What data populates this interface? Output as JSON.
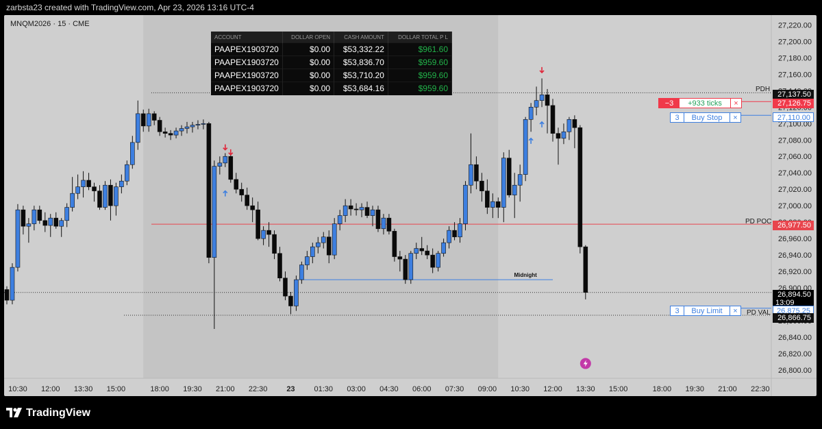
{
  "header": {
    "text": "zarbsta23 created with TradingView.com, Apr 23, 2026 13:16 UTC-4"
  },
  "symbol": {
    "text": "MNQM2026 · 15 · CME"
  },
  "account_table": {
    "columns": [
      "ACCOUNT",
      "DOLLAR OPEN",
      "CASH AMOUNT",
      "DOLLAR TOTAL P L"
    ],
    "rows": [
      [
        "PAAPEX1903720",
        "$0.00",
        "$53,332.22",
        "$961.60"
      ],
      [
        "PAAPEX1903720",
        "$0.00",
        "$53,836.70",
        "$959.60"
      ],
      [
        "PAAPEX1903720",
        "$0.00",
        "$53,710.20",
        "$959.60"
      ],
      [
        "PAAPEX1903720",
        "$0.00",
        "$53,684.16",
        "$959.60"
      ]
    ]
  },
  "orders": {
    "position": {
      "qty": "−3",
      "text": "+933 ticks",
      "close": "×",
      "price": "27,126.75"
    },
    "buy_stop": {
      "qty": "3",
      "text": "Buy Stop",
      "close": "×",
      "price": "27,110.00"
    },
    "buy_limit": {
      "qty": "3",
      "text": "Buy Limit",
      "close": "×",
      "price": "26,875.25"
    }
  },
  "levels": {
    "pdh": {
      "label": "PDH",
      "price": "27,137.50"
    },
    "pd_poc": {
      "label": "PD POC",
      "price": "26,977.50"
    },
    "pd_val": {
      "label": "PD VAL",
      "price": "26,866.75"
    },
    "midnight": {
      "label": "Midnight"
    },
    "last": {
      "price": "26,894.50",
      "countdown": "13:09"
    }
  },
  "footer": {
    "brand": "TradingView"
  },
  "colors": {
    "up": "#3d7fe0",
    "down": "#0a0a0a",
    "session_bg": "#c4c4c4",
    "panel_bg": "#cfcfcf",
    "poc": "#e8454d",
    "position_red": "#f0394a",
    "order_blue": "#3d7fe0",
    "pnl_green": "#22b34a"
  },
  "chart_data": {
    "type": "candlestick",
    "title": "MNQM2026 · 15 · CME",
    "y_ticks": [
      26800,
      26820,
      26840,
      26860,
      26880,
      26900,
      26920,
      26940,
      26960,
      26980,
      27000,
      27020,
      27040,
      27060,
      27080,
      27100,
      27120,
      27140,
      27160,
      27180,
      27200,
      27220
    ],
    "y_tick_labels": [
      "26,800.00",
      "26,820.00",
      "26,840.00",
      "26,860.00",
      "26,880.00",
      "26,900.00",
      "26,920.00",
      "26,940.00",
      "26,960.00",
      "26,980.00",
      "27,000.00",
      "27,020.00",
      "27,040.00",
      "27,060.00",
      "27,080.00",
      "27,100.00",
      "27,120.00",
      "27,140.00",
      "27,160.00",
      "27,180.00",
      "27,200.00",
      "27,220.00"
    ],
    "ylim": [
      26790,
      27232
    ],
    "x_tick_labels": [
      "10:30",
      "12:00",
      "13:30",
      "15:00",
      "18:00",
      "19:30",
      "21:00",
      "22:30",
      "23",
      "01:30",
      "03:00",
      "04:30",
      "06:00",
      "07:30",
      "09:00",
      "10:30",
      "12:00",
      "13:30",
      "15:00",
      "18:00",
      "19:30",
      "21:00",
      "22:30"
    ],
    "x_tick_index": [
      2,
      8,
      14,
      20,
      28,
      34,
      40,
      46,
      52,
      58,
      64,
      70,
      76,
      82,
      88,
      94,
      100,
      106,
      112,
      120,
      126,
      132,
      138
    ],
    "session_shade_range": [
      25,
      90
    ],
    "candles": [
      [
        26898,
        26902,
        26880,
        26885
      ],
      [
        26885,
        26930,
        26880,
        26925
      ],
      [
        26925,
        27002,
        26920,
        26995
      ],
      [
        26995,
        27000,
        26965,
        26975
      ],
      [
        26975,
        26985,
        26955,
        26978
      ],
      [
        26978,
        27000,
        26970,
        26995
      ],
      [
        26995,
        27000,
        26978,
        26982
      ],
      [
        26982,
        26992,
        26968,
        26976
      ],
      [
        26976,
        26990,
        26962,
        26985
      ],
      [
        26985,
        26992,
        26972,
        26975
      ],
      [
        26975,
        26985,
        26962,
        26982
      ],
      [
        26982,
        27003,
        26974,
        26998
      ],
      [
        26998,
        27035,
        26993,
        27015
      ],
      [
        27015,
        27038,
        27008,
        27023
      ],
      [
        27023,
        27042,
        27010,
        27031
      ],
      [
        27031,
        27040,
        27019,
        27023
      ],
      [
        27023,
        27028,
        27005,
        27018
      ],
      [
        27018,
        27025,
        26995,
        26998
      ],
      [
        26998,
        27030,
        26995,
        27025
      ],
      [
        27025,
        27032,
        26982,
        27000
      ],
      [
        27000,
        27028,
        26988,
        27023
      ],
      [
        27023,
        27038,
        27015,
        27030
      ],
      [
        27030,
        27055,
        27025,
        27050
      ],
      [
        27050,
        27085,
        27045,
        27077
      ],
      [
        27077,
        27128,
        27068,
        27112
      ],
      [
        27112,
        27117,
        27090,
        27097
      ],
      [
        27097,
        27118,
        27090,
        27112
      ],
      [
        27112,
        27115,
        27098,
        27104
      ],
      [
        27104,
        27108,
        27085,
        27090
      ],
      [
        27090,
        27095,
        27083,
        27088
      ],
      [
        27088,
        27092,
        27080,
        27086
      ],
      [
        27086,
        27095,
        27082,
        27091
      ],
      [
        27091,
        27098,
        27085,
        27094
      ],
      [
        27094,
        27102,
        27088,
        27096
      ],
      [
        27096,
        27102,
        27089,
        27098
      ],
      [
        27098,
        27104,
        27093,
        27099
      ],
      [
        27099,
        27105,
        27093,
        27100
      ],
      [
        27100,
        27102,
        26930,
        26937
      ],
      [
        26937,
        27055,
        26850,
        27048
      ],
      [
        27048,
        27060,
        27038,
        27052
      ],
      [
        27052,
        27064,
        27047,
        27060
      ],
      [
        27060,
        27065,
        27028,
        27032
      ],
      [
        27032,
        27040,
        27015,
        27020
      ],
      [
        27020,
        27028,
        27005,
        27013
      ],
      [
        27013,
        27022,
        26995,
        27000
      ],
      [
        27000,
        27010,
        26980,
        26995
      ],
      [
        26995,
        27005,
        26958,
        26960
      ],
      [
        26960,
        26975,
        26952,
        26970
      ],
      [
        26970,
        26980,
        26950,
        26965
      ],
      [
        26965,
        26970,
        26935,
        26942
      ],
      [
        26942,
        26950,
        26908,
        26912
      ],
      [
        26912,
        26920,
        26885,
        26890
      ],
      [
        26890,
        26895,
        26868,
        26878
      ],
      [
        26878,
        26915,
        26872,
        26910
      ],
      [
        26910,
        26932,
        26905,
        26928
      ],
      [
        26928,
        26945,
        26922,
        26938
      ],
      [
        26938,
        26955,
        26930,
        26950
      ],
      [
        26950,
        26962,
        26942,
        26955
      ],
      [
        26955,
        26968,
        26948,
        26962
      ],
      [
        26962,
        26970,
        26930,
        26940
      ],
      [
        26940,
        26985,
        26935,
        26978
      ],
      [
        26978,
        26995,
        26970,
        26988
      ],
      [
        26988,
        27008,
        26980,
        27000
      ],
      [
        27000,
        27008,
        26988,
        26996
      ],
      [
        26996,
        27003,
        26988,
        26995
      ],
      [
        26995,
        27003,
        26986,
        26998
      ],
      [
        26998,
        27005,
        26985,
        26988
      ],
      [
        26988,
        27000,
        26975,
        26995
      ],
      [
        26995,
        27000,
        26968,
        26972
      ],
      [
        26972,
        26990,
        26965,
        26985
      ],
      [
        26985,
        26990,
        26965,
        26969
      ],
      [
        26969,
        26972,
        26932,
        26938
      ],
      [
        26938,
        26945,
        26920,
        26935
      ],
      [
        26935,
        26940,
        26905,
        26910
      ],
      [
        26910,
        26945,
        26905,
        26942
      ],
      [
        26942,
        26955,
        26935,
        26948
      ],
      [
        26948,
        26962,
        26940,
        26945
      ],
      [
        26945,
        26952,
        26935,
        26940
      ],
      [
        26940,
        26948,
        26918,
        26925
      ],
      [
        26925,
        26945,
        26920,
        26942
      ],
      [
        26942,
        26960,
        26938,
        26955
      ],
      [
        26955,
        26975,
        26948,
        26970
      ],
      [
        26970,
        26980,
        26958,
        26962
      ],
      [
        26962,
        26985,
        26955,
        26978
      ],
      [
        26978,
        27030,
        26970,
        27025
      ],
      [
        27025,
        27088,
        27015,
        27050
      ],
      [
        27050,
        27060,
        27020,
        27030
      ],
      [
        27030,
        27040,
        27005,
        27018
      ],
      [
        27018,
        27032,
        26990,
        26998
      ],
      [
        26998,
        27015,
        26985,
        27005
      ],
      [
        27005,
        27010,
        26985,
        26998
      ],
      [
        26998,
        27065,
        26980,
        27058
      ],
      [
        27058,
        27068,
        27010,
        27013
      ],
      [
        27013,
        27040,
        26985,
        27025
      ],
      [
        27025,
        27050,
        27005,
        27038
      ],
      [
        27038,
        27108,
        27030,
        27105
      ],
      [
        27105,
        27125,
        27090,
        27120
      ],
      [
        27120,
        27145,
        27110,
        27128
      ],
      [
        27128,
        27155,
        27120,
        27135
      ],
      [
        27135,
        27142,
        27088,
        27122
      ],
      [
        27122,
        27130,
        27078,
        27088
      ],
      [
        27088,
        27095,
        27050,
        27082
      ],
      [
        27082,
        27100,
        27075,
        27090
      ],
      [
        27090,
        27108,
        27080,
        27105
      ],
      [
        27105,
        27110,
        27070,
        27095
      ],
      [
        27095,
        27098,
        26942,
        26950
      ],
      [
        26950,
        26952,
        26886,
        26894.5
      ]
    ]
  }
}
